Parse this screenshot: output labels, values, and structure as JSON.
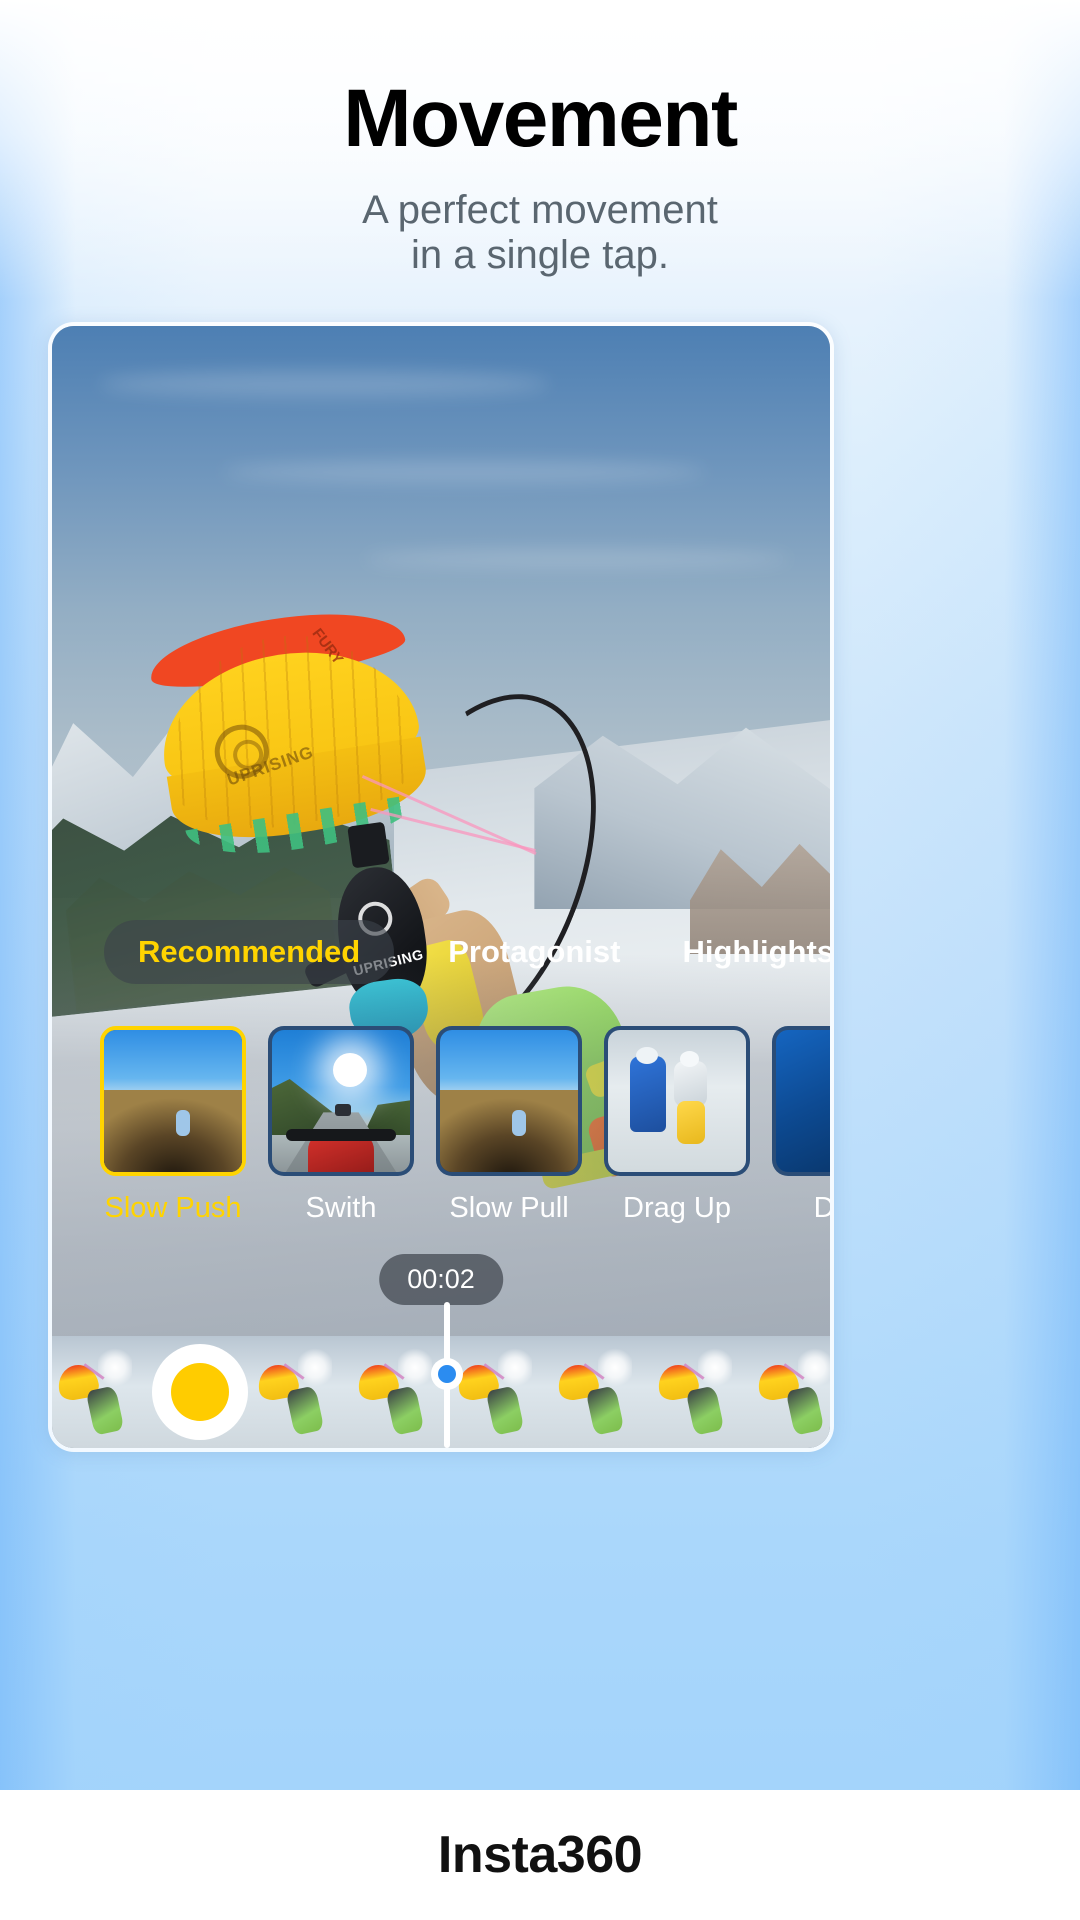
{
  "header": {
    "title": "Movement",
    "subtitle_line1": "A perfect movement",
    "subtitle_line2": "in a single tap."
  },
  "tabs": [
    {
      "label": "Recommended",
      "active": true
    },
    {
      "label": "Protagonist",
      "active": false
    },
    {
      "label": "Highlights",
      "active": false
    }
  ],
  "effects": [
    {
      "label": "Slow Push",
      "selected": true,
      "art": "tv-canyon"
    },
    {
      "label": "Swith",
      "selected": false,
      "art": "tv-road"
    },
    {
      "label": "Slow Pull",
      "selected": false,
      "art": "tv-canyon"
    },
    {
      "label": "Drag Up",
      "selected": false,
      "art": "tv-snowski"
    },
    {
      "label": "Drag",
      "selected": false,
      "art": "tv-blue"
    }
  ],
  "timeline": {
    "timestamp": "00:02",
    "record_button": "record-button",
    "playhead": "playhead"
  },
  "footer": {
    "brand": "Insta360"
  },
  "colors": {
    "accent_yellow": "#ffd400",
    "record_yellow": "#ffcc00",
    "playhead_blue": "#2b8cf0",
    "title_black": "#000000",
    "subtitle_gray": "#5a6670",
    "page_blue": "#a4d4fb"
  },
  "scene": {
    "description": "snowkite-rider-over-snowy-mountain"
  }
}
